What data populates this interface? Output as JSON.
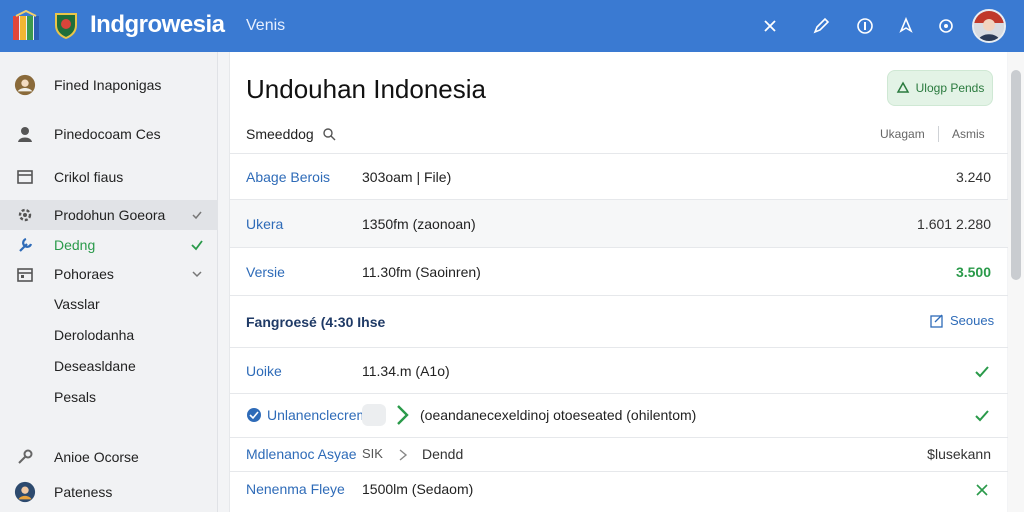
{
  "header": {
    "app_title": "Indgrowesia",
    "tab_label": "Venis",
    "icons": [
      "flag-logo-icon",
      "crest-icon",
      "close-icon",
      "pen-icon",
      "info-icon",
      "pin-icon",
      "settings-icon"
    ],
    "accent_color": "#3a7ad2"
  },
  "sidebar": {
    "items": [
      {
        "label": "Fined Inaponigas",
        "icon": "avatar-icon"
      },
      {
        "label": "Pinedocoam Ces",
        "icon": "person-icon"
      },
      {
        "label": "Crikol fiaus",
        "icon": "window-icon"
      },
      {
        "label": "Prodohun Goeora",
        "icon": "gear-icon"
      },
      {
        "label": "Dedng",
        "icon": "wrench-icon"
      },
      {
        "label": "Pohoraes",
        "icon": "calendar-icon"
      }
    ],
    "sub_items": [
      "Vasslar",
      "Derolodanha",
      "Deseasldane",
      "Pesals"
    ],
    "bottom_items": [
      {
        "label": "Anioe Ocorse",
        "icon": "key-icon"
      },
      {
        "label": "Pateness",
        "icon": "profile-icon"
      }
    ]
  },
  "main": {
    "title": "Undouhan Indonesia",
    "upload_button": "Ulogp Pends",
    "speed_label": "Smeeddog",
    "speed_right_1": "Ukagam",
    "speed_right_2": "Asmis",
    "rows": [
      {
        "name": "Abage Berois",
        "detail": "303oam | File)",
        "value": "3.240"
      },
      {
        "name": "Ukera",
        "detail": "1350fm  (zaonoan)",
        "value": "1.601 2.280"
      },
      {
        "name": "Versie",
        "detail": "11.30fm  (Saoinren)",
        "value": "3.500"
      }
    ],
    "section": {
      "title": "Fangroesé (4:30 Ihse",
      "action": "Seoues"
    },
    "section_rows": [
      {
        "name": "Uoike",
        "detail": "11.34.m  (A1o)"
      },
      {
        "name": "Unlanenclecrem",
        "detail": "(oeandanecexeldinoj otoeseated (ohilentom)"
      },
      {
        "name": "Mdlenanoc Asyae",
        "mid": "SIK",
        "detail": "Dendd",
        "value": "$lusekann"
      },
      {
        "name": "Nenenma Fleye",
        "detail": "1500lm  (Sedaom)"
      }
    ]
  }
}
